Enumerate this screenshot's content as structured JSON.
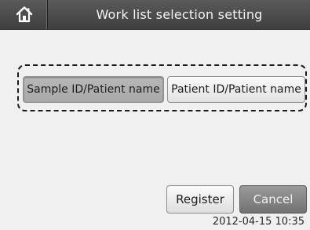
{
  "window": {
    "title": "Work list selection setting",
    "home_icon": "home-icon"
  },
  "selection": {
    "options": [
      {
        "label": "Sample ID/Patient name",
        "selected": true
      },
      {
        "label": "Patient ID/Patient name",
        "selected": false
      }
    ]
  },
  "actions": {
    "register_label": "Register",
    "cancel_label": "Cancel"
  },
  "status": {
    "datetime": "2012-04-15 10:35"
  },
  "colors": {
    "titlebar": "#4a4a4a",
    "selected_option": "#b0b0b0",
    "cancel_button": "#808080"
  }
}
